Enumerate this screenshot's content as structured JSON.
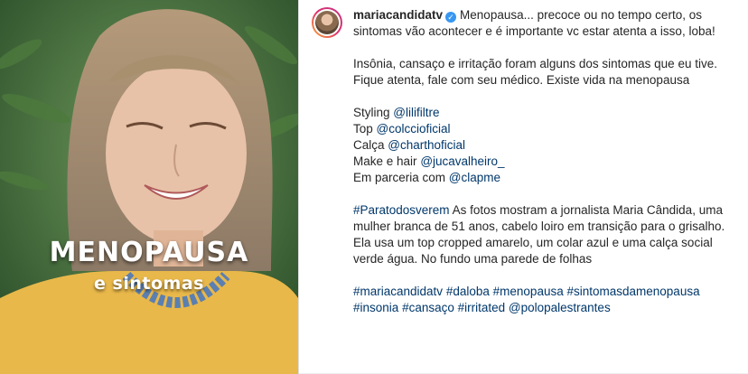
{
  "image": {
    "overlay_title": "MENOPAUSA",
    "overlay_subtitle": "e sintomas"
  },
  "post": {
    "username": "mariacandidatv",
    "caption_first": "Menopausa... precoce ou no tempo certo, os sintomas vão acontecer e é importante vc estar atenta a isso, loba!",
    "paragraph2": "Insônia, cansaço e irritação foram alguns dos sintomas que eu tive. Fique atenta, fale com seu médico. Existe vida na menopausa",
    "credits": [
      {
        "label": "Styling",
        "handle": "@lilifiltre"
      },
      {
        "label": "Top",
        "handle": "@colccioficial"
      },
      {
        "label": "Calça",
        "handle": "@charthoficial"
      },
      {
        "label": "Make e hair",
        "handle": "@jucavalheiro_"
      },
      {
        "label": "Em parceria com",
        "handle": "@clapme"
      }
    ],
    "accessibility_tag": "#Paratodosverem",
    "accessibility_text": "As fotos mostram a jornalista Maria Cândida, uma mulher branca de 51 anos, cabelo loiro em transição para o grisalho. Ela usa um top cropped amarelo, um colar azul e uma calça social verde água. No fundo uma parede de folhas",
    "hashtags": [
      "#mariacandidatv",
      "#daloba",
      "#menopausa",
      "#sintomasdamenopausa",
      "#insonia",
      "#cansaço",
      "#irritated",
      "@polopalestrantes"
    ]
  },
  "colors": {
    "link": "#00376b",
    "verified": "#3897f0",
    "text": "#262626"
  }
}
